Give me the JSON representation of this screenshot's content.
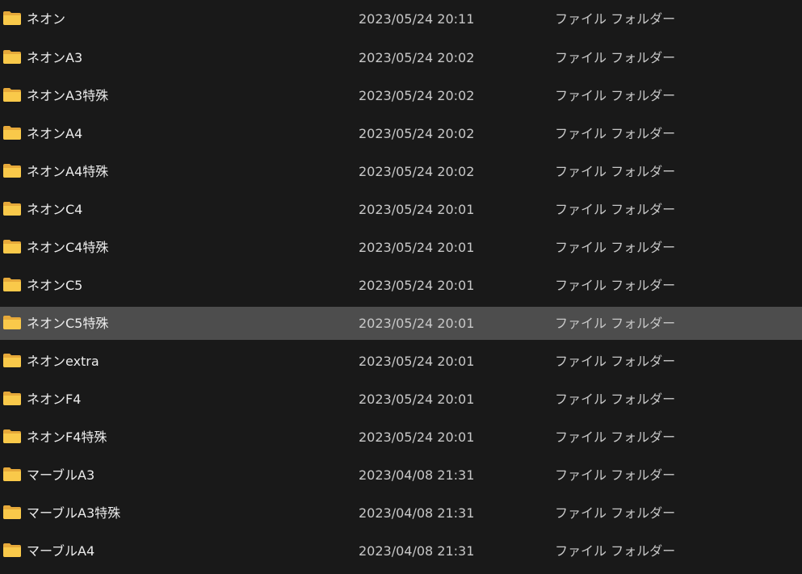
{
  "colors": {
    "background": "#191919",
    "selected_row": "#4d4d4d",
    "folder_front": "#f9c94a",
    "folder_back": "#e6a93a"
  },
  "rows": [
    {
      "name": "ネオン",
      "date": "2023/05/24 20:11",
      "type": "ファイル フォルダー",
      "icon": "folder-icon",
      "selected": false
    },
    {
      "name": "ネオンA3",
      "date": "2023/05/24 20:02",
      "type": "ファイル フォルダー",
      "icon": "folder-icon",
      "selected": false
    },
    {
      "name": "ネオンA3特殊",
      "date": "2023/05/24 20:02",
      "type": "ファイル フォルダー",
      "icon": "folder-icon",
      "selected": false
    },
    {
      "name": "ネオンA4",
      "date": "2023/05/24 20:02",
      "type": "ファイル フォルダー",
      "icon": "folder-icon",
      "selected": false
    },
    {
      "name": "ネオンA4特殊",
      "date": "2023/05/24 20:02",
      "type": "ファイル フォルダー",
      "icon": "folder-icon",
      "selected": false
    },
    {
      "name": "ネオンC4",
      "date": "2023/05/24 20:01",
      "type": "ファイル フォルダー",
      "icon": "folder-icon",
      "selected": false
    },
    {
      "name": "ネオンC4特殊",
      "date": "2023/05/24 20:01",
      "type": "ファイル フォルダー",
      "icon": "folder-icon",
      "selected": false
    },
    {
      "name": "ネオンC5",
      "date": "2023/05/24 20:01",
      "type": "ファイル フォルダー",
      "icon": "folder-icon",
      "selected": false
    },
    {
      "name": "ネオンC5特殊",
      "date": "2023/05/24 20:01",
      "type": "ファイル フォルダー",
      "icon": "folder-icon",
      "selected": true
    },
    {
      "name": "ネオンextra",
      "date": "2023/05/24 20:01",
      "type": "ファイル フォルダー",
      "icon": "folder-icon",
      "selected": false
    },
    {
      "name": "ネオンF4",
      "date": "2023/05/24 20:01",
      "type": "ファイル フォルダー",
      "icon": "folder-icon",
      "selected": false
    },
    {
      "name": "ネオンF4特殊",
      "date": "2023/05/24 20:01",
      "type": "ファイル フォルダー",
      "icon": "folder-icon",
      "selected": false
    },
    {
      "name": "マーブルA3",
      "date": "2023/04/08 21:31",
      "type": "ファイル フォルダー",
      "icon": "folder-icon",
      "selected": false
    },
    {
      "name": "マーブルA3特殊",
      "date": "2023/04/08 21:31",
      "type": "ファイル フォルダー",
      "icon": "folder-icon",
      "selected": false
    },
    {
      "name": "マーブルA4",
      "date": "2023/04/08 21:31",
      "type": "ファイル フォルダー",
      "icon": "folder-icon",
      "selected": false
    }
  ]
}
